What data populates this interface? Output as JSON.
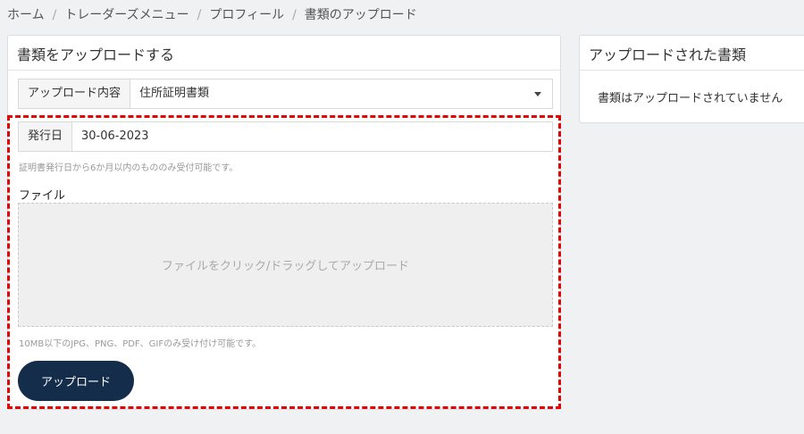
{
  "breadcrumb": {
    "items": [
      "ホーム",
      "トレーダーズメニュー",
      "プロフィール",
      "書類のアップロード"
    ],
    "separator": "/"
  },
  "upload_panel": {
    "title": "書類をアップロードする",
    "type_label": "アップロード内容",
    "type_value": "住所証明書類",
    "date_label": "発行日",
    "date_value": "30-06-2023",
    "date_hint": "証明書発行日から6か月以内のもののみ受付可能です。",
    "file_label": "ファイル",
    "dropzone_text": "ファイルをクリック/ドラッグしてアップロード",
    "file_hint": "10MB以下のJPG、PNG、PDF、GIFのみ受け付け可能です。",
    "upload_button": "アップロード"
  },
  "uploaded_panel": {
    "title": "アップロードされた書類",
    "empty_message": "書類はアップロードされていません"
  },
  "colors": {
    "background": "#f0f1f3",
    "button": "#132d4a",
    "highlight": "#e60000",
    "dropzone": "#efefef"
  }
}
